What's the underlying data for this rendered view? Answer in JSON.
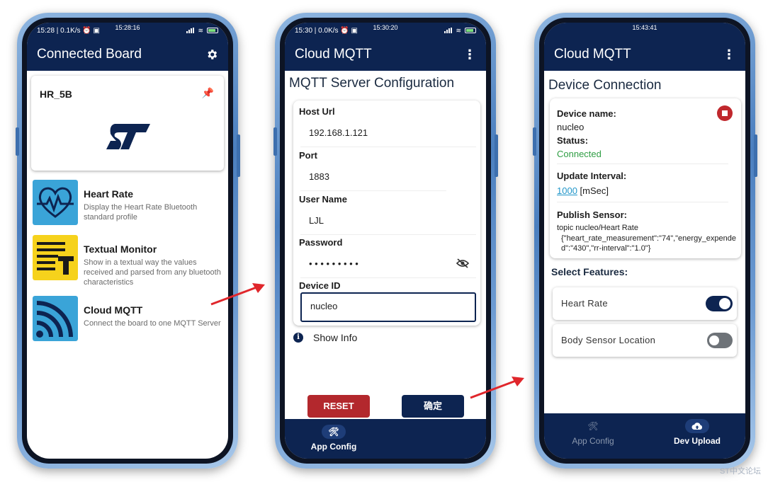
{
  "colors": {
    "navy": "#0d2451",
    "red": "#b3282d",
    "green": "#2f9e44",
    "link": "#2196c9"
  },
  "phone1": {
    "status_left": "15:28 | 0.1K/s ⏰ ▣",
    "status_center": "15:28:16",
    "title": "Connected Board",
    "settings_icon": "gear-icon",
    "board_name": "HR_5B",
    "pin_icon": "pin-icon",
    "features": [
      {
        "title": "Heart Rate",
        "desc": "Display the Heart Rate Bluetooth standard profile",
        "icon": "heart-rate-icon"
      },
      {
        "title": "Textual Monitor",
        "desc": "Show in a textual way the values received and parsed from any bluetooth characteristics",
        "icon": "text-monitor-icon"
      },
      {
        "title": "Cloud MQTT",
        "desc": "Connect the board to one MQTT Server",
        "icon": "cloud-mqtt-icon"
      }
    ]
  },
  "phone2": {
    "status_left": "15:30 | 0.0K/s ⏰ ▣",
    "status_center": "15:30:20",
    "title": "Cloud MQTT",
    "section_title": "MQTT Server Configuration",
    "fields": {
      "host_label": "Host Url",
      "host_value": "192.168.1.121",
      "port_label": "Port",
      "port_value": "1883",
      "user_label": "User Name",
      "user_value": "LJL",
      "password_label": "Password",
      "password_value": "• • • • • • • • •",
      "device_label": "Device ID",
      "device_value": "nucleo"
    },
    "show_info": "Show Info",
    "reset_label": "RESET",
    "confirm_label": "确定",
    "nav": [
      {
        "label": "App Config",
        "icon": "tools-icon"
      }
    ]
  },
  "phone3": {
    "status_center": "15:43:41",
    "title": "Cloud MQTT",
    "section_title": "Device Connection",
    "device_name_label": "Device name:",
    "device_name_value": "nucleo",
    "status_label": "Status:",
    "status_value": "Connected",
    "interval_label": "Update Interval:",
    "interval_value": "1000",
    "interval_unit": " [mSec]",
    "publish_label": "Publish Sensor:",
    "publish_topic": "topic nucleo/Heart Rate",
    "publish_payload": "{\"heart_rate_measurement\":\"74\",\"energy_expended\":\"430\",\"rr-interval\":\"1.0\"}",
    "select_features": "Select Features:",
    "switches": [
      {
        "label": "Heart Rate",
        "on": true
      },
      {
        "label": "Body Sensor Location",
        "on": false
      }
    ],
    "nav": [
      {
        "label": "App Config",
        "icon": "tools-icon"
      },
      {
        "label": "Dev Upload",
        "icon": "cloud-upload-icon"
      }
    ]
  },
  "watermark": "ST中文论坛"
}
